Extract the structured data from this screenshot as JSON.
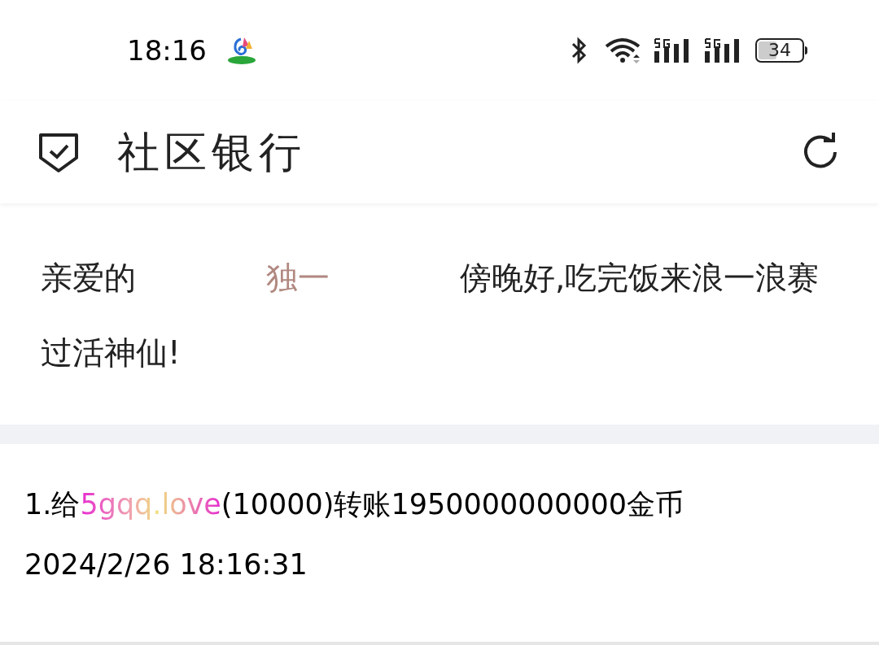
{
  "status_bar": {
    "time": "18:16",
    "battery": "34"
  },
  "header": {
    "title": "社区银行"
  },
  "greeting": {
    "prefix": "亲爱的",
    "name": "独一",
    "message": "傍晚好,吃完饭来浪一浪赛过活神仙!"
  },
  "transactions": [
    {
      "prefix": "1.给",
      "recipient": "5gqq.love",
      "suffix": "(10000)转账1950000000000金币",
      "timestamp": "2024/2/26 18:16:31"
    }
  ]
}
